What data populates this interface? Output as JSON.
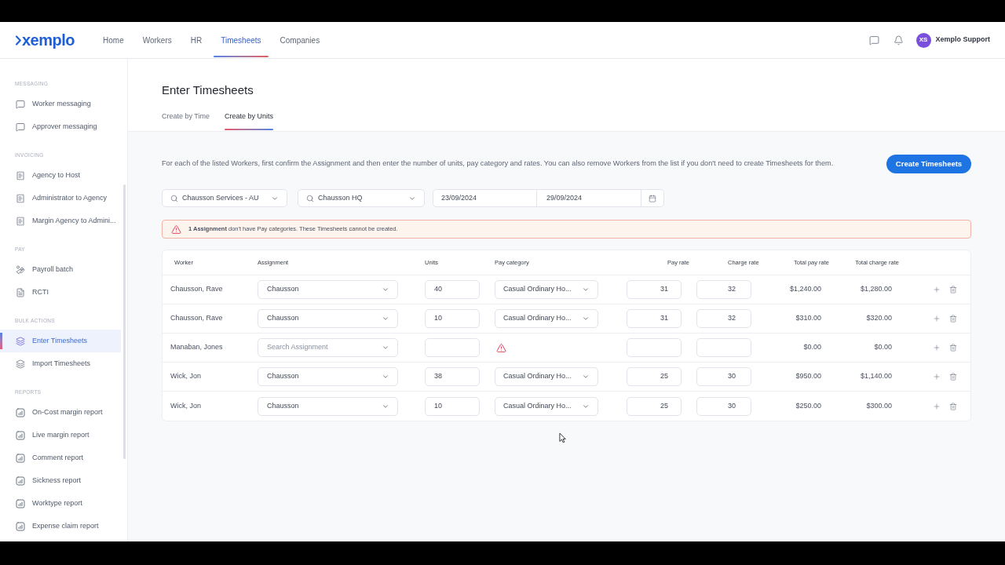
{
  "top_nav": {
    "logo": "xemplo",
    "items": [
      {
        "label": "Home",
        "selected": false
      },
      {
        "label": "Workers",
        "selected": false
      },
      {
        "label": "HR",
        "selected": false
      },
      {
        "label": "Timesheets",
        "selected": true
      },
      {
        "label": "Companies",
        "selected": false
      }
    ],
    "user": {
      "initials": "XS",
      "name": "Xemplo Support"
    }
  },
  "sidebar": {
    "sections": [
      {
        "title": "MESSAGING",
        "items": [
          {
            "label": "Worker messaging",
            "kind": "message",
            "selected": false
          },
          {
            "label": "Approver messaging",
            "kind": "message",
            "selected": false
          }
        ]
      },
      {
        "title": "INVOICING",
        "items": [
          {
            "label": "Agency to Host",
            "kind": "invoice",
            "selected": false
          },
          {
            "label": "Administrator to Agency",
            "kind": "invoice",
            "selected": false
          },
          {
            "label": "Margin Agency to Admini...",
            "kind": "invoice",
            "selected": false
          }
        ]
      },
      {
        "title": "PAY",
        "items": [
          {
            "label": "Payroll batch",
            "kind": "payroll",
            "selected": false
          },
          {
            "label": "RCTI",
            "kind": "document",
            "selected": false
          }
        ]
      },
      {
        "title": "BULK ACTIONS",
        "items": [
          {
            "label": "Enter Timesheets",
            "kind": "layers",
            "selected": true
          },
          {
            "label": "Import Timesheets",
            "kind": "layers",
            "selected": false
          }
        ]
      },
      {
        "title": "REPORTS",
        "items": [
          {
            "label": "On-Cost margin report",
            "kind": "report",
            "selected": false
          },
          {
            "label": "Live margin report",
            "kind": "report",
            "selected": false
          },
          {
            "label": "Comment report",
            "kind": "report",
            "selected": false
          },
          {
            "label": "Sickness report",
            "kind": "report",
            "selected": false
          },
          {
            "label": "Worktype report",
            "kind": "report",
            "selected": false
          },
          {
            "label": "Expense claim report",
            "kind": "report",
            "selected": false
          }
        ]
      }
    ]
  },
  "page": {
    "title": "Enter Timesheets",
    "tabs": [
      {
        "label": "Create by Time",
        "selected": false
      },
      {
        "label": "Create by Units",
        "selected": true
      }
    ],
    "description": "For each of the listed Workers, first confirm the Assignment and then enter the number of units, pay category and rates. You can also remove Workers from the list if you don't need to create Timesheets for them.",
    "create_button": "Create Timesheets",
    "filters": {
      "company": "Chausson Services - AU",
      "site": "Chausson HQ",
      "date_from": "23/09/2024",
      "date_to": "29/09/2024"
    },
    "alert": "**1 Assignment** don't have Pay categories. These Timesheets cannot be created.",
    "table": {
      "columns": [
        "Worker",
        "Assignment",
        "Units",
        "Pay category",
        "Pay rate",
        "Charge rate",
        "Total pay rate",
        "Total charge rate"
      ],
      "rows": [
        {
          "worker": "Chausson, Rave",
          "assignment": {
            "value": "Chausson"
          },
          "units": "40",
          "warning": false,
          "pay_category": "Casual Ordinary Ho...",
          "pay_rate": "31",
          "charge_rate": "32",
          "total_pay_rate": "$1,240.00",
          "total_charge_rate": "$1,280.00"
        },
        {
          "worker": "Chausson, Rave",
          "assignment": {
            "value": "Chausson"
          },
          "units": "10",
          "warning": false,
          "pay_category": "Casual Ordinary Ho...",
          "pay_rate": "31",
          "charge_rate": "32",
          "total_pay_rate": "$310.00",
          "total_charge_rate": "$320.00"
        },
        {
          "worker": "Manaban, Jones",
          "assignment": {
            "placeholder": "Search Assignment"
          },
          "warning": true,
          "total_pay_rate": "$0.00",
          "total_charge_rate": "$0.00"
        },
        {
          "worker": "Wick, Jon",
          "assignment": {
            "value": "Chausson"
          },
          "units": "38",
          "warning": false,
          "pay_category": "Casual Ordinary Ho...",
          "pay_rate": "25",
          "charge_rate": "30",
          "total_pay_rate": "$950.00",
          "total_charge_rate": "$1,140.00"
        },
        {
          "worker": "Wick, Jon",
          "assignment": {
            "value": "Chausson"
          },
          "units": "10",
          "warning": false,
          "pay_category": "Casual Ordinary Ho...",
          "pay_rate": "25",
          "charge_rate": "30",
          "total_pay_rate": "$250.00",
          "total_charge_rate": "$300.00"
        }
      ]
    }
  }
}
